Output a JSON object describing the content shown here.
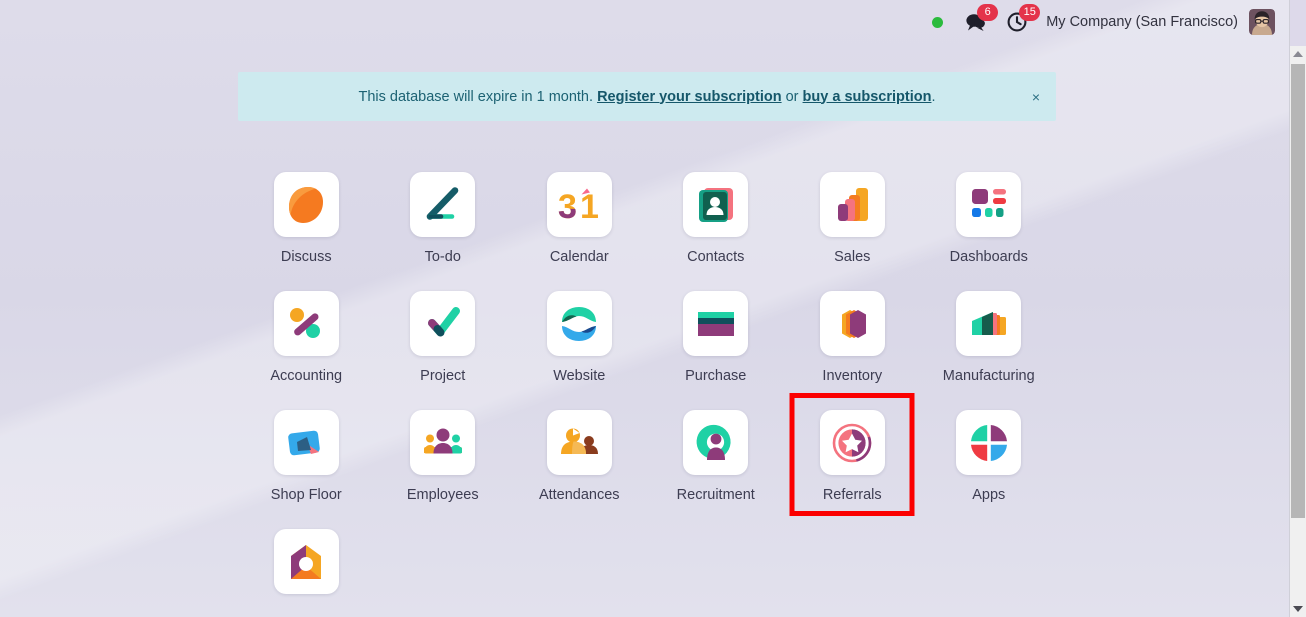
{
  "topbar": {
    "status_indicator": "online",
    "status_color": "#2bbb3d",
    "badges": [
      {
        "icon": "chat-bubble-icon",
        "count": "6"
      },
      {
        "icon": "activity-clock-icon",
        "count": "15"
      }
    ],
    "badge_color": "#e4334a",
    "company": "My Company (San Francisco)",
    "avatar_alt": "user-avatar"
  },
  "banner": {
    "text_before": "This database will expire in 1 month.",
    "link_register": "Register your subscription",
    "text_or": "or",
    "link_buy": "buy a subscription",
    "text_end": ".",
    "close_label": "×",
    "background": "#cdeaef",
    "text_color": "#1c6273"
  },
  "apps": [
    {
      "name": "Discuss",
      "icon": "discuss-icon",
      "highlighted": false
    },
    {
      "name": "To-do",
      "icon": "todo-icon",
      "highlighted": false
    },
    {
      "name": "Calendar",
      "icon": "calendar-icon",
      "highlighted": false
    },
    {
      "name": "Contacts",
      "icon": "contacts-icon",
      "highlighted": false
    },
    {
      "name": "Sales",
      "icon": "sales-icon",
      "highlighted": false
    },
    {
      "name": "Dashboards",
      "icon": "dashboards-icon",
      "highlighted": false
    },
    {
      "name": "Accounting",
      "icon": "accounting-icon",
      "highlighted": false
    },
    {
      "name": "Project",
      "icon": "project-icon",
      "highlighted": false
    },
    {
      "name": "Website",
      "icon": "website-icon",
      "highlighted": false
    },
    {
      "name": "Purchase",
      "icon": "purchase-icon",
      "highlighted": false
    },
    {
      "name": "Inventory",
      "icon": "inventory-icon",
      "highlighted": false
    },
    {
      "name": "Manufacturing",
      "icon": "manufacturing-icon",
      "highlighted": false
    },
    {
      "name": "Shop Floor",
      "icon": "shopfloor-icon",
      "highlighted": false
    },
    {
      "name": "Employees",
      "icon": "employees-icon",
      "highlighted": false
    },
    {
      "name": "Attendances",
      "icon": "attendances-icon",
      "highlighted": false
    },
    {
      "name": "Recruitment",
      "icon": "recruitment-icon",
      "highlighted": false
    },
    {
      "name": "Referrals",
      "icon": "referrals-icon",
      "highlighted": true
    },
    {
      "name": "Apps",
      "icon": "apps-icon",
      "highlighted": false
    },
    {
      "name": "",
      "icon": "maintenance-icon",
      "highlighted": false
    }
  ],
  "highlight": {
    "color": "#fb0000",
    "target": "Referrals"
  },
  "scrollbar": {
    "position": "top",
    "thumb_color": "#b6b6b6"
  }
}
